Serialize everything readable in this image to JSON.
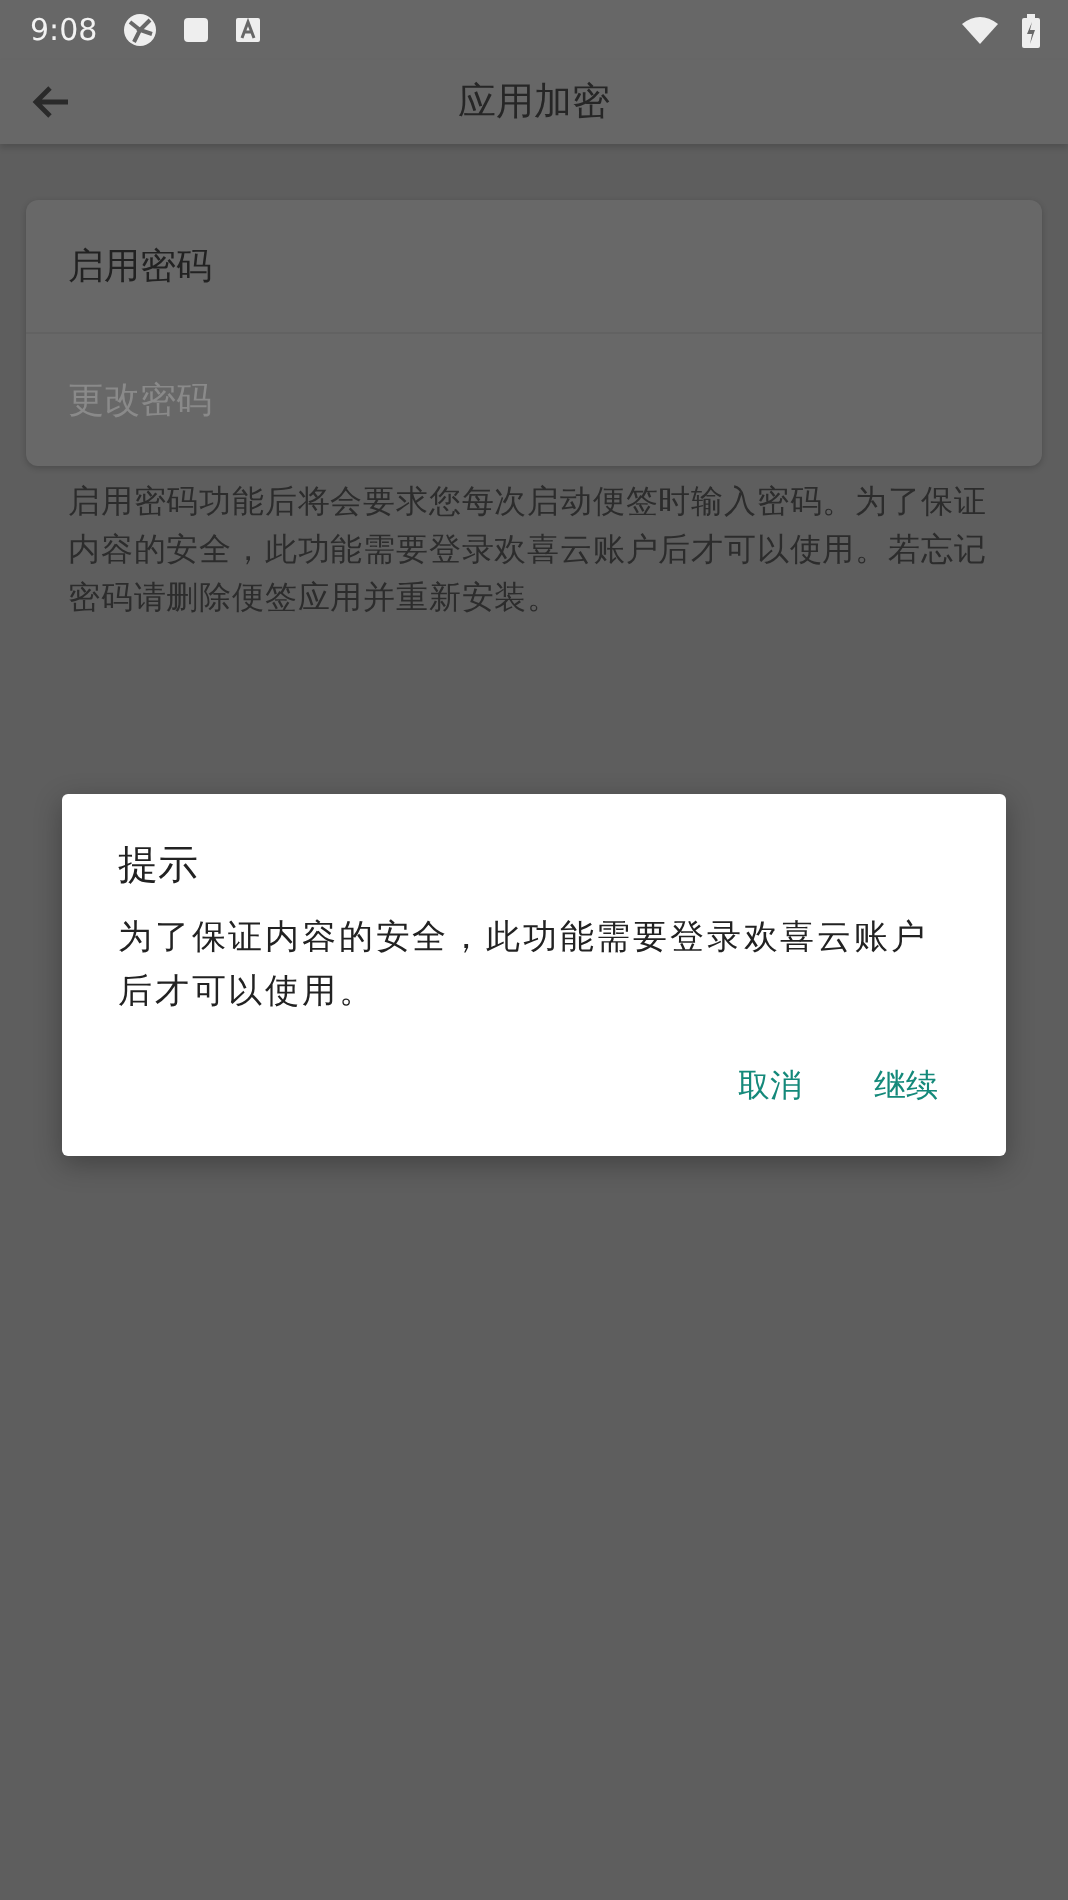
{
  "status_bar": {
    "time": "9:08"
  },
  "app_bar": {
    "title": "应用加密"
  },
  "settings": [
    {
      "label": "启用密码",
      "disabled": false
    },
    {
      "label": "更改密码",
      "disabled": true
    }
  ],
  "description": "启用密码功能后将会要求您每次启动便签时输入密码。为了保证内容的安全，此功能需要登录欢喜云账户后才可以使用。若忘记密码请删除便签应用并重新安装。",
  "dialog": {
    "title": "提示",
    "message": "为了保证内容的安全，此功能需要登录欢喜云账户后才可以使用。",
    "buttons": [
      "取消",
      "继续"
    ]
  }
}
